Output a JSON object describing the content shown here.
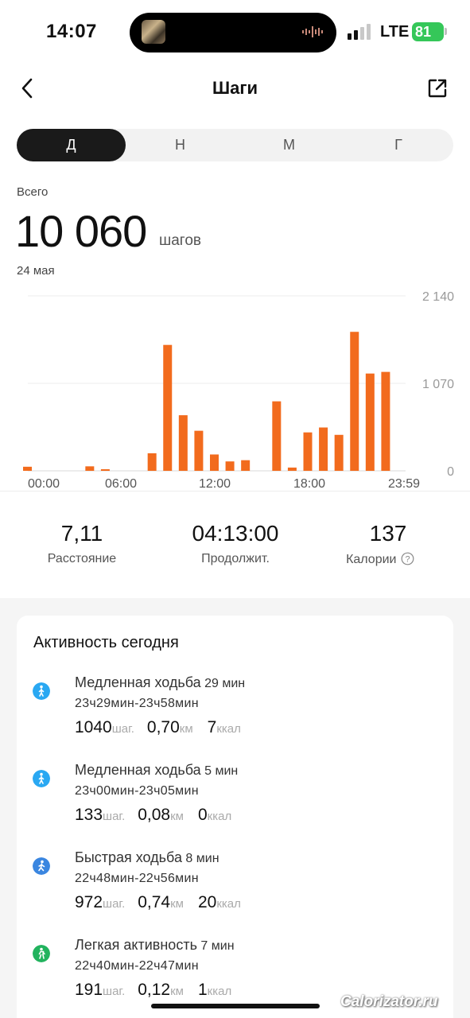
{
  "status": {
    "time": "14:07",
    "network": "LTE",
    "battery": "81"
  },
  "header": {
    "title": "Шаги",
    "back_icon": "chevron-left-icon",
    "share_icon": "share-icon"
  },
  "tabs": [
    {
      "label": "Д",
      "active": true
    },
    {
      "label": "Н",
      "active": false
    },
    {
      "label": "М",
      "active": false
    },
    {
      "label": "Г",
      "active": false
    }
  ],
  "summary": {
    "label": "Всего",
    "value": "10 060",
    "unit": "шагов",
    "date": "24 мая"
  },
  "chart_data": {
    "type": "bar",
    "color": "#f26b1d",
    "ylim": [
      0,
      2140
    ],
    "y_ticks": [
      "2 140",
      "1 070",
      "0"
    ],
    "x_ticks": [
      "00:00",
      "06:00",
      "12:00",
      "18:00",
      "23:59"
    ],
    "x_unit_hours": [
      0,
      24
    ],
    "bars": [
      {
        "hour": 0,
        "value": 50
      },
      {
        "hour": 4,
        "value": 55
      },
      {
        "hour": 5,
        "value": 10
      },
      {
        "hour": 8,
        "value": 215
      },
      {
        "hour": 9,
        "value": 1540
      },
      {
        "hour": 10,
        "value": 680
      },
      {
        "hour": 11,
        "value": 490
      },
      {
        "hour": 12,
        "value": 200
      },
      {
        "hour": 13,
        "value": 115
      },
      {
        "hour": 14,
        "value": 130
      },
      {
        "hour": 16,
        "value": 850
      },
      {
        "hour": 17,
        "value": 40
      },
      {
        "hour": 18,
        "value": 470
      },
      {
        "hour": 19,
        "value": 530
      },
      {
        "hour": 20,
        "value": 440
      },
      {
        "hour": 21,
        "value": 1700
      },
      {
        "hour": 22,
        "value": 1190
      },
      {
        "hour": 23,
        "value": 1210
      }
    ]
  },
  "stats": [
    {
      "value": "7,11",
      "label": "Расстояние"
    },
    {
      "value": "04:13:00",
      "label": "Продолжит."
    },
    {
      "value": "137",
      "label": "Калории"
    }
  ],
  "activity": {
    "title": "Активность сегодня",
    "items": [
      {
        "name": "Медленная ходьба",
        "duration": "29 мин",
        "range": "23ч29мин-23ч58мин",
        "steps": "1040",
        "steps_unit": "шаг.",
        "dist": "0,70",
        "dist_unit": "км",
        "kcal": "7",
        "kcal_unit": "ккал",
        "icon": "walk-icon",
        "icon_color": "#2aa8f2"
      },
      {
        "name": "Медленная ходьба",
        "duration": "5 мин",
        "range": "23ч00мин-23ч05мин",
        "steps": "133",
        "steps_unit": "шаг.",
        "dist": "0,08",
        "dist_unit": "км",
        "kcal": "0",
        "kcal_unit": "ккал",
        "icon": "walk-icon",
        "icon_color": "#2aa8f2"
      },
      {
        "name": "Быстрая ходьба",
        "duration": "8 мин",
        "range": "22ч48мин-22ч56мин",
        "steps": "972",
        "steps_unit": "шаг.",
        "dist": "0,74",
        "dist_unit": "км",
        "kcal": "20",
        "kcal_unit": "ккал",
        "icon": "fast-walk-icon",
        "icon_color": "#3a86e0"
      },
      {
        "name": "Легкая активность",
        "duration": "7 мин",
        "range": "22ч40мин-22ч47мин",
        "steps": "191",
        "steps_unit": "шаг.",
        "dist": "0,12",
        "dist_unit": "км",
        "kcal": "1",
        "kcal_unit": "ккал",
        "icon": "light-activity-icon",
        "icon_color": "#22b35e"
      }
    ]
  },
  "watermark": "Calorizator.ru"
}
